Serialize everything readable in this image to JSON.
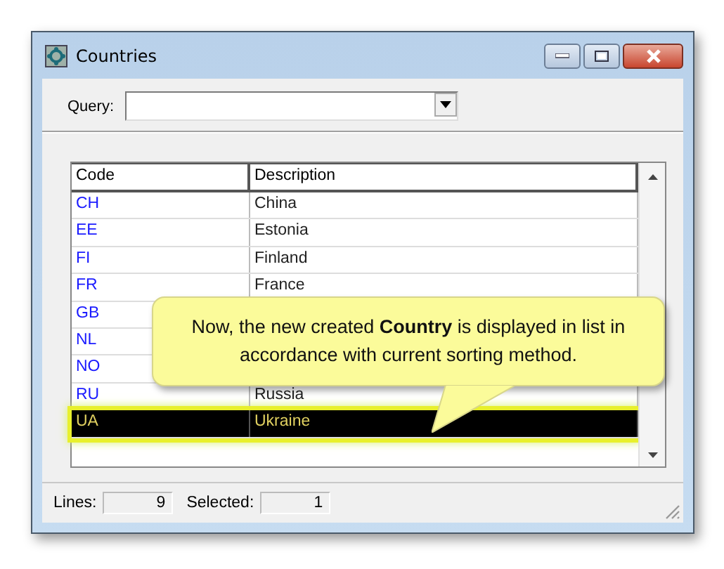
{
  "window": {
    "title": "Countries"
  },
  "query": {
    "label": "Query:"
  },
  "table": {
    "columns": [
      "Code",
      "Description"
    ],
    "rows": [
      {
        "code": "CH",
        "description": "China",
        "selected": false
      },
      {
        "code": "EE",
        "description": "Estonia",
        "selected": false
      },
      {
        "code": "FI",
        "description": "Finland",
        "selected": false
      },
      {
        "code": "FR",
        "description": "France",
        "selected": false
      },
      {
        "code": "GB",
        "selected": false
      },
      {
        "code": "NL",
        "selected": false
      },
      {
        "code": "NO",
        "selected": false
      },
      {
        "code": "RU",
        "description": "Russia",
        "selected": false
      },
      {
        "code": "UA",
        "description": "Ukraine",
        "selected": true
      }
    ]
  },
  "callout": {
    "text": "Now, the new created **Country** is displayed in list in accordance with current sorting method."
  },
  "status_bar": {
    "lines_label": "Lines:",
    "lines": "9",
    "selected_label": "Selected:",
    "selected": "1"
  }
}
